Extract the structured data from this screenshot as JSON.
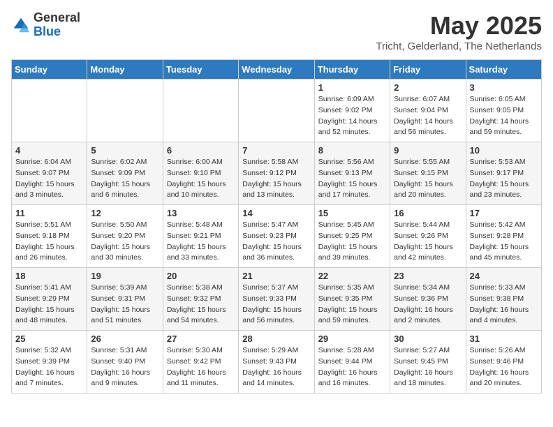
{
  "header": {
    "logo_general": "General",
    "logo_blue": "Blue",
    "month_year": "May 2025",
    "location": "Tricht, Gelderland, The Netherlands"
  },
  "weekdays": [
    "Sunday",
    "Monday",
    "Tuesday",
    "Wednesday",
    "Thursday",
    "Friday",
    "Saturday"
  ],
  "weeks": [
    [
      {
        "day": "",
        "info": ""
      },
      {
        "day": "",
        "info": ""
      },
      {
        "day": "",
        "info": ""
      },
      {
        "day": "",
        "info": ""
      },
      {
        "day": "1",
        "info": "Sunrise: 6:09 AM\nSunset: 9:02 PM\nDaylight: 14 hours\nand 52 minutes."
      },
      {
        "day": "2",
        "info": "Sunrise: 6:07 AM\nSunset: 9:04 PM\nDaylight: 14 hours\nand 56 minutes."
      },
      {
        "day": "3",
        "info": "Sunrise: 6:05 AM\nSunset: 9:05 PM\nDaylight: 14 hours\nand 59 minutes."
      }
    ],
    [
      {
        "day": "4",
        "info": "Sunrise: 6:04 AM\nSunset: 9:07 PM\nDaylight: 15 hours\nand 3 minutes."
      },
      {
        "day": "5",
        "info": "Sunrise: 6:02 AM\nSunset: 9:09 PM\nDaylight: 15 hours\nand 6 minutes."
      },
      {
        "day": "6",
        "info": "Sunrise: 6:00 AM\nSunset: 9:10 PM\nDaylight: 15 hours\nand 10 minutes."
      },
      {
        "day": "7",
        "info": "Sunrise: 5:58 AM\nSunset: 9:12 PM\nDaylight: 15 hours\nand 13 minutes."
      },
      {
        "day": "8",
        "info": "Sunrise: 5:56 AM\nSunset: 9:13 PM\nDaylight: 15 hours\nand 17 minutes."
      },
      {
        "day": "9",
        "info": "Sunrise: 5:55 AM\nSunset: 9:15 PM\nDaylight: 15 hours\nand 20 minutes."
      },
      {
        "day": "10",
        "info": "Sunrise: 5:53 AM\nSunset: 9:17 PM\nDaylight: 15 hours\nand 23 minutes."
      }
    ],
    [
      {
        "day": "11",
        "info": "Sunrise: 5:51 AM\nSunset: 9:18 PM\nDaylight: 15 hours\nand 26 minutes."
      },
      {
        "day": "12",
        "info": "Sunrise: 5:50 AM\nSunset: 9:20 PM\nDaylight: 15 hours\nand 30 minutes."
      },
      {
        "day": "13",
        "info": "Sunrise: 5:48 AM\nSunset: 9:21 PM\nDaylight: 15 hours\nand 33 minutes."
      },
      {
        "day": "14",
        "info": "Sunrise: 5:47 AM\nSunset: 9:23 PM\nDaylight: 15 hours\nand 36 minutes."
      },
      {
        "day": "15",
        "info": "Sunrise: 5:45 AM\nSunset: 9:25 PM\nDaylight: 15 hours\nand 39 minutes."
      },
      {
        "day": "16",
        "info": "Sunrise: 5:44 AM\nSunset: 9:26 PM\nDaylight: 15 hours\nand 42 minutes."
      },
      {
        "day": "17",
        "info": "Sunrise: 5:42 AM\nSunset: 9:28 PM\nDaylight: 15 hours\nand 45 minutes."
      }
    ],
    [
      {
        "day": "18",
        "info": "Sunrise: 5:41 AM\nSunset: 9:29 PM\nDaylight: 15 hours\nand 48 minutes."
      },
      {
        "day": "19",
        "info": "Sunrise: 5:39 AM\nSunset: 9:31 PM\nDaylight: 15 hours\nand 51 minutes."
      },
      {
        "day": "20",
        "info": "Sunrise: 5:38 AM\nSunset: 9:32 PM\nDaylight: 15 hours\nand 54 minutes."
      },
      {
        "day": "21",
        "info": "Sunrise: 5:37 AM\nSunset: 9:33 PM\nDaylight: 15 hours\nand 56 minutes."
      },
      {
        "day": "22",
        "info": "Sunrise: 5:35 AM\nSunset: 9:35 PM\nDaylight: 15 hours\nand 59 minutes."
      },
      {
        "day": "23",
        "info": "Sunrise: 5:34 AM\nSunset: 9:36 PM\nDaylight: 16 hours\nand 2 minutes."
      },
      {
        "day": "24",
        "info": "Sunrise: 5:33 AM\nSunset: 9:38 PM\nDaylight: 16 hours\nand 4 minutes."
      }
    ],
    [
      {
        "day": "25",
        "info": "Sunrise: 5:32 AM\nSunset: 9:39 PM\nDaylight: 16 hours\nand 7 minutes."
      },
      {
        "day": "26",
        "info": "Sunrise: 5:31 AM\nSunset: 9:40 PM\nDaylight: 16 hours\nand 9 minutes."
      },
      {
        "day": "27",
        "info": "Sunrise: 5:30 AM\nSunset: 9:42 PM\nDaylight: 16 hours\nand 11 minutes."
      },
      {
        "day": "28",
        "info": "Sunrise: 5:29 AM\nSunset: 9:43 PM\nDaylight: 16 hours\nand 14 minutes."
      },
      {
        "day": "29",
        "info": "Sunrise: 5:28 AM\nSunset: 9:44 PM\nDaylight: 16 hours\nand 16 minutes."
      },
      {
        "day": "30",
        "info": "Sunrise: 5:27 AM\nSunset: 9:45 PM\nDaylight: 16 hours\nand 18 minutes."
      },
      {
        "day": "31",
        "info": "Sunrise: 5:26 AM\nSunset: 9:46 PM\nDaylight: 16 hours\nand 20 minutes."
      }
    ]
  ]
}
